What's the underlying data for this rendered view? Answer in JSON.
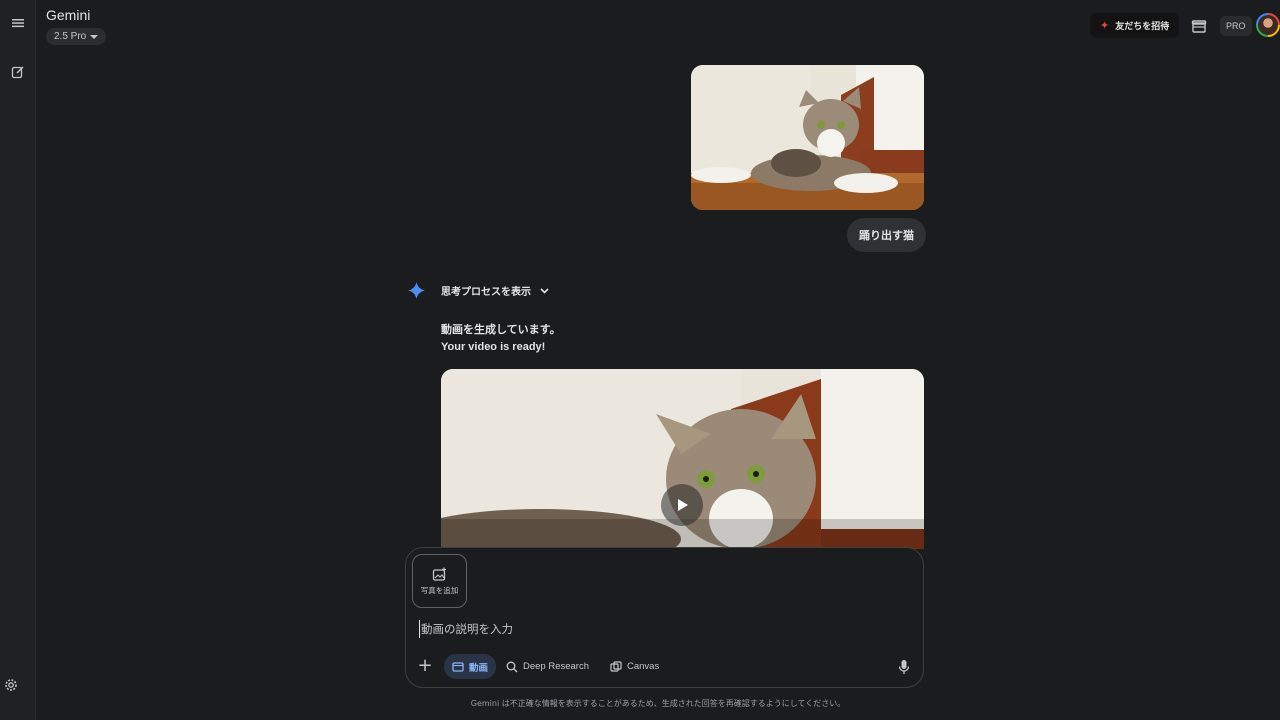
{
  "app": {
    "title": "Gemini",
    "model": "2.5 Pro"
  },
  "header": {
    "invite_label": "友だちを招待",
    "plan_badge": "PRO"
  },
  "conversation": {
    "user_prompt": "踊り出す猫",
    "thinking_label": "思考プロセスを表示",
    "response_line1": "動画を生成しています。",
    "response_line2": "Your video is ready!"
  },
  "composer": {
    "add_photo_label": "写真を追加",
    "placeholder": "動画の説明を入力",
    "tools": {
      "video": "動画",
      "deep_research": "Deep Research",
      "canvas": "Canvas"
    }
  },
  "footer": {
    "disclaimer": "Gemini は不正確な情報を表示することがあるため、生成された回答を再確認するようにしてください。"
  },
  "colors": {
    "background": "#1b1c1d",
    "accent": "#8ab4f8",
    "brand_spark": "#e8453c"
  }
}
